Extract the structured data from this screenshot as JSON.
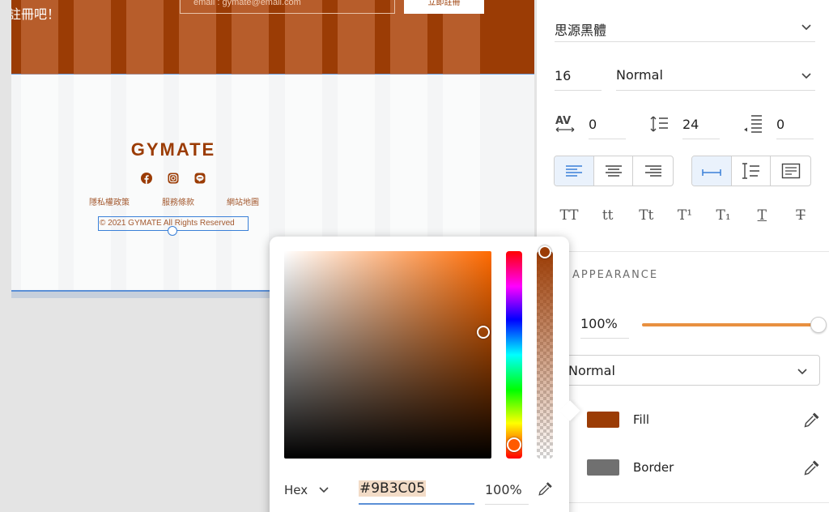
{
  "artboard": {
    "banner": {
      "cta_text": "註冊吧！",
      "email_placeholder": "email : gymate@email.com",
      "signup_label": "立即註冊",
      "color": "#9B3C05"
    },
    "footer": {
      "logo": "GYMATE",
      "social_icons": [
        "facebook-icon",
        "instagram-icon",
        "line-icon"
      ],
      "links": [
        "隱私權政策",
        "服務條款",
        "網站地圖"
      ],
      "copyright": "© 2021  GYMATE  All Rights Reserved"
    }
  },
  "panel": {
    "font_family": "思源黑體",
    "font_size": "16",
    "font_weight": "Normal",
    "char_spacing": "0",
    "line_spacing": "24",
    "paragraph_spacing": "0",
    "text_styles": [
      "TT",
      "tt",
      "Tt",
      "T¹",
      "T₁",
      "T",
      "T"
    ],
    "appearance": {
      "title": "APPEARANCE",
      "opacity": "100%",
      "opacity_value": 1.0,
      "blend_mode": "Normal"
    },
    "fill": {
      "label": "Fill",
      "color": "#9B3C05"
    },
    "border": {
      "label": "Border",
      "color": "#707070"
    }
  },
  "color_picker": {
    "mode": "Hex",
    "hex_value": "#9B3C05",
    "alpha": "100%"
  }
}
